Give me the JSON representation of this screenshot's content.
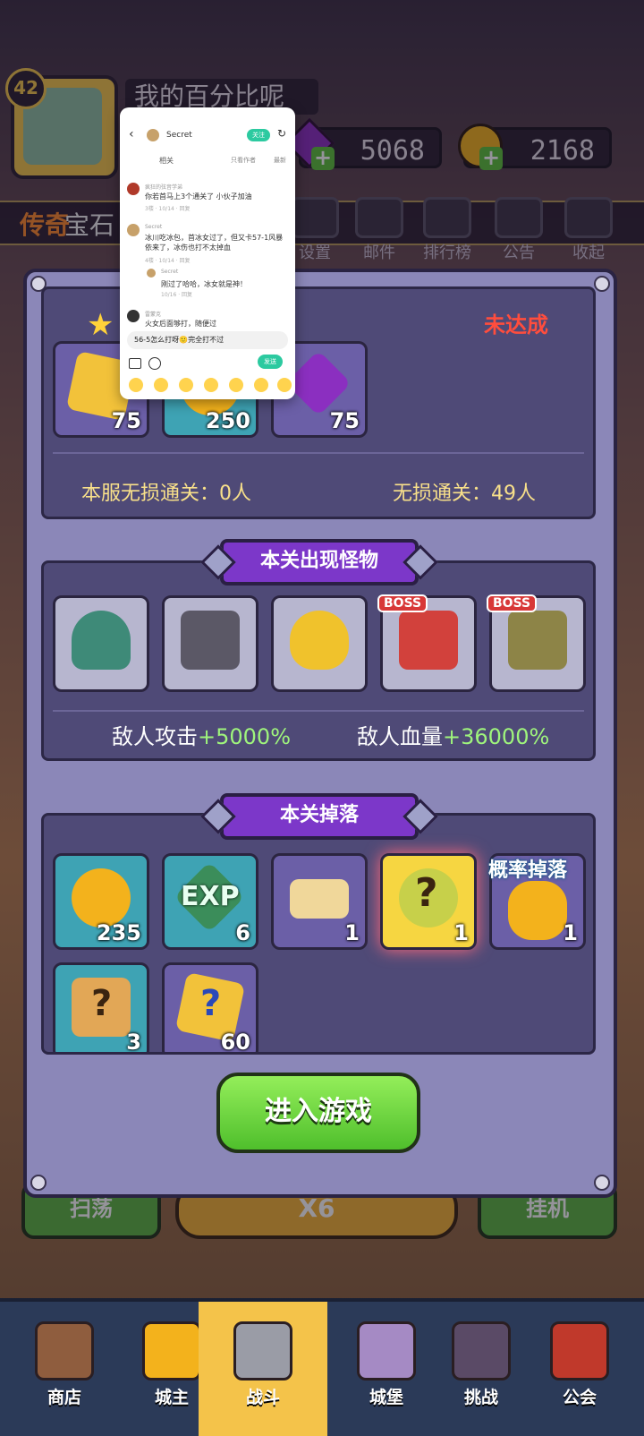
{
  "hud": {
    "level": "42",
    "player_name": "我的百分比呢",
    "gems": "5068",
    "coins": "2168",
    "marquee_part1": "传奇",
    "marquee_part2": "宝石",
    "menu": [
      "设置",
      "邮件",
      "排行榜",
      "公告",
      "收起"
    ]
  },
  "chat": {
    "username": "Secret",
    "follow_label": "关注",
    "tabs": [
      "相关",
      "只看作者",
      "最新"
    ],
    "comments": [
      {
        "name": "疯狂的弦音学弟",
        "text": "你若首马上3个通关了 小伙子加油",
        "meta": "3楼 · 10/14 · 回复"
      },
      {
        "name": "Secret",
        "text": "冰川吃冰包，首冰女过了，但又卡57-1风暴依来了，冰伤也打不太掉血",
        "meta": "4楼 · 10/14 · 回复"
      },
      {
        "name": "Secret",
        "text": "刚过了哈哈，冰女就是神！",
        "meta": "10/16 · 回复"
      },
      {
        "name": "雷蒙克",
        "text": "火女后面够打，随便过",
        "meta": ""
      }
    ],
    "input_text": "56-5怎么打呀🙂完全打不过",
    "send_label": "发送"
  },
  "panel": {
    "star_status": "未达成",
    "rewards": [
      {
        "count": "75",
        "kind": "puzzle"
      },
      {
        "count": "250",
        "kind": "coin"
      },
      {
        "count": "75",
        "kind": "gem"
      }
    ],
    "server_clear_label": "本服无损通关：0人",
    "clear_label": "无损通关：49人",
    "monsters_title": "本关出现怪物",
    "monsters": [
      {
        "name": "manta",
        "boss": ""
      },
      {
        "name": "skull-knight",
        "boss": ""
      },
      {
        "name": "fire-spirit",
        "boss": ""
      },
      {
        "name": "red-demon",
        "boss": "BOSS"
      },
      {
        "name": "stone-golem",
        "boss": "BOSS"
      }
    ],
    "enemy_attack_label": "敌人攻击",
    "enemy_attack_value": "+5000%",
    "enemy_hp_label": "敌人血量",
    "enemy_hp_value": "+36000%",
    "drops_title": "本关掉落",
    "drops": [
      {
        "count": "235",
        "kind": "coin"
      },
      {
        "count": "6",
        "kind": "exp",
        "text": "EXP"
      },
      {
        "count": "1",
        "kind": "ticket"
      },
      {
        "count": "1",
        "kind": "mystery-gems"
      },
      {
        "count": "1",
        "kind": "flame-badge",
        "tag": "概率掉落"
      },
      {
        "count": "3",
        "kind": "scroll"
      },
      {
        "count": "60",
        "kind": "puzzle"
      }
    ],
    "enter_label": "进入游戏"
  },
  "behind": {
    "sweep": "扫荡",
    "multiplier": "X6",
    "hangup": "挂机"
  },
  "nav": [
    "商店",
    "城主",
    "战斗",
    "城堡",
    "挑战",
    "公会"
  ],
  "colors": {
    "accent_purple": "#7c37c9",
    "green_value": "#9ff57c",
    "danger": "#ff4d3d"
  }
}
